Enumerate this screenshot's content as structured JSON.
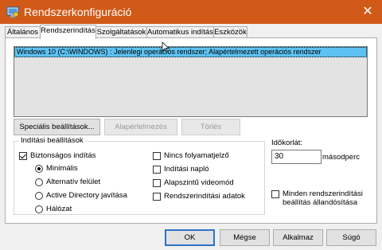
{
  "window": {
    "title": "Rendszerkonfiguráció",
    "close_symbol": "✕",
    "title_icon": "system-config-icon",
    "accent": "#D15A18"
  },
  "tabs": [
    {
      "label": "Általános",
      "active": false
    },
    {
      "label": "Rendszerindítás",
      "active": true
    },
    {
      "label": "Szolgáltatások",
      "active": false
    },
    {
      "label": "Automatikus indítás",
      "active": false
    },
    {
      "label": "Eszközök",
      "active": false
    }
  ],
  "os_list": {
    "entries": [
      "Windows 10 (C:\\WINDOWS) : Jelenlegi operációs rendszer; Alapértelmezett operációs rendszer"
    ],
    "selected_color": "#5DC2F2"
  },
  "list_buttons": {
    "advanced": "Speciális beállítások...",
    "set_default": "Alapértelmezés",
    "delete": "Törlés"
  },
  "boot_options": {
    "title": "Indítási beállítások",
    "safe_boot": {
      "label": "Biztonságos indítás",
      "checked": true
    },
    "radios": [
      {
        "label": "Minimális",
        "checked": true
      },
      {
        "label": "Alternatív felület",
        "checked": false
      },
      {
        "label": "Active Directory javítása",
        "checked": false
      },
      {
        "label": "Hálózat",
        "checked": false
      }
    ],
    "checkboxes": [
      {
        "label": "Nincs folyamatjelző",
        "checked": false
      },
      {
        "label": "Indítási napló",
        "checked": false
      },
      {
        "label": "Alapszintű videomód",
        "checked": false
      },
      {
        "label": "Rendszerindítási adatok",
        "checked": false
      }
    ]
  },
  "timeout": {
    "label": "Időkorlát:",
    "value": "30",
    "unit": "másodperc"
  },
  "permanent": {
    "label_line1": "Minden rendszerindítási",
    "label_line2": "beállítás állandósítása",
    "checked": false
  },
  "dialog_buttons": {
    "ok": "OK",
    "cancel": "Mégse",
    "apply": "Alkalmaz",
    "help": "Súgó"
  }
}
